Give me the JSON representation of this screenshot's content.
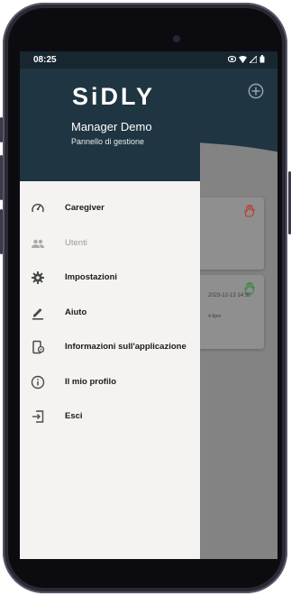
{
  "status_bar": {
    "time": "08:25"
  },
  "drawer": {
    "logo": "SiDLY",
    "user_name": "Manager Demo",
    "subtitle": "Pannello di gestione",
    "items": [
      {
        "label": "Caregiver",
        "icon": "gauge-icon",
        "enabled": true
      },
      {
        "label": "Utenti",
        "icon": "users-icon",
        "enabled": false
      },
      {
        "label": "Impostazioni",
        "icon": "gear-icon",
        "enabled": true
      },
      {
        "label": "Aiuto",
        "icon": "pencil-icon",
        "enabled": true
      },
      {
        "label": "Informazioni sull'applicazione",
        "icon": "app-info-icon",
        "enabled": true
      },
      {
        "label": "Il mio profilo",
        "icon": "info-circle-icon",
        "enabled": true
      },
      {
        "label": "Esci",
        "icon": "logout-icon",
        "enabled": true
      }
    ]
  },
  "background": {
    "cards": [
      {
        "hand_color": "#c0392b",
        "timestamp": "",
        "detail": ""
      },
      {
        "hand_color": "#2e8b3e",
        "timestamp": "2023-12-13 14:30",
        "detail": "4-5pm"
      }
    ]
  },
  "colors": {
    "header_bg": "#1f3541",
    "drawer_bg": "#f4f3f1",
    "scrim": "#838383"
  }
}
